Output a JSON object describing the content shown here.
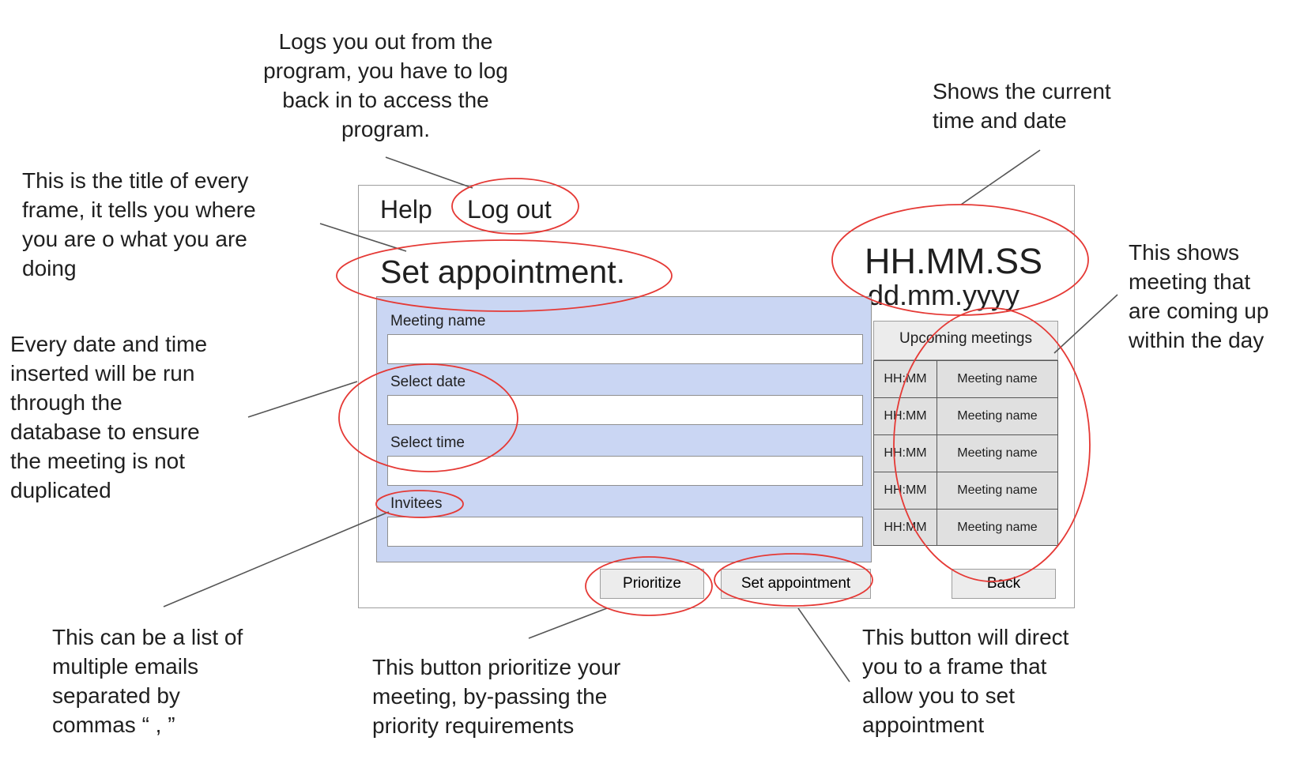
{
  "annotations": {
    "logout": "Logs you out from the\nprogram, you have to log\nback in to access the\nprogram.",
    "clock": "Shows the current\ntime and date",
    "title": "This is the title of every\nframe, it tells you where\nyou are o what you are\ndoing",
    "upcoming": "This shows\nmeeting that\nare coming up\nwithin the day",
    "date_check": "Every date and time\ninserted will be run\nthrough the\ndatabase to ensure\nthe meeting is not\nduplicated",
    "invitees": "This can be a list of\nmultiple emails\nseparated by\ncommas “ , ”",
    "prioritize": "This button prioritize your\nmeeting, by-passing the\npriority requirements",
    "set_appointment": "This button will direct\nyou to a frame that\nallow you to set\nappointment"
  },
  "menu": {
    "help": "Help",
    "logout": "Log out"
  },
  "frame_title": "Set appointment.",
  "clock": {
    "time": "HH.MM.SS",
    "date": "dd.mm.yyyy"
  },
  "form": {
    "meeting_name_label": "Meeting name",
    "select_date_label": "Select date",
    "select_time_label": "Select time",
    "invitees_label": "Invitees"
  },
  "upcoming": {
    "header": "Upcoming meetings",
    "rows": [
      {
        "time": "HH:MM",
        "name": "Meeting name"
      },
      {
        "time": "HH:MM",
        "name": "Meeting name"
      },
      {
        "time": "HH:MM",
        "name": "Meeting name"
      },
      {
        "time": "HH:MM",
        "name": "Meeting name"
      },
      {
        "time": "HH:MM",
        "name": "Meeting name"
      }
    ]
  },
  "buttons": {
    "prioritize": "Prioritize",
    "set_appointment": "Set appointment",
    "back": "Back"
  },
  "colors": {
    "highlight": "#e53935",
    "panel": "#cad6f3",
    "button": "#ececec"
  }
}
